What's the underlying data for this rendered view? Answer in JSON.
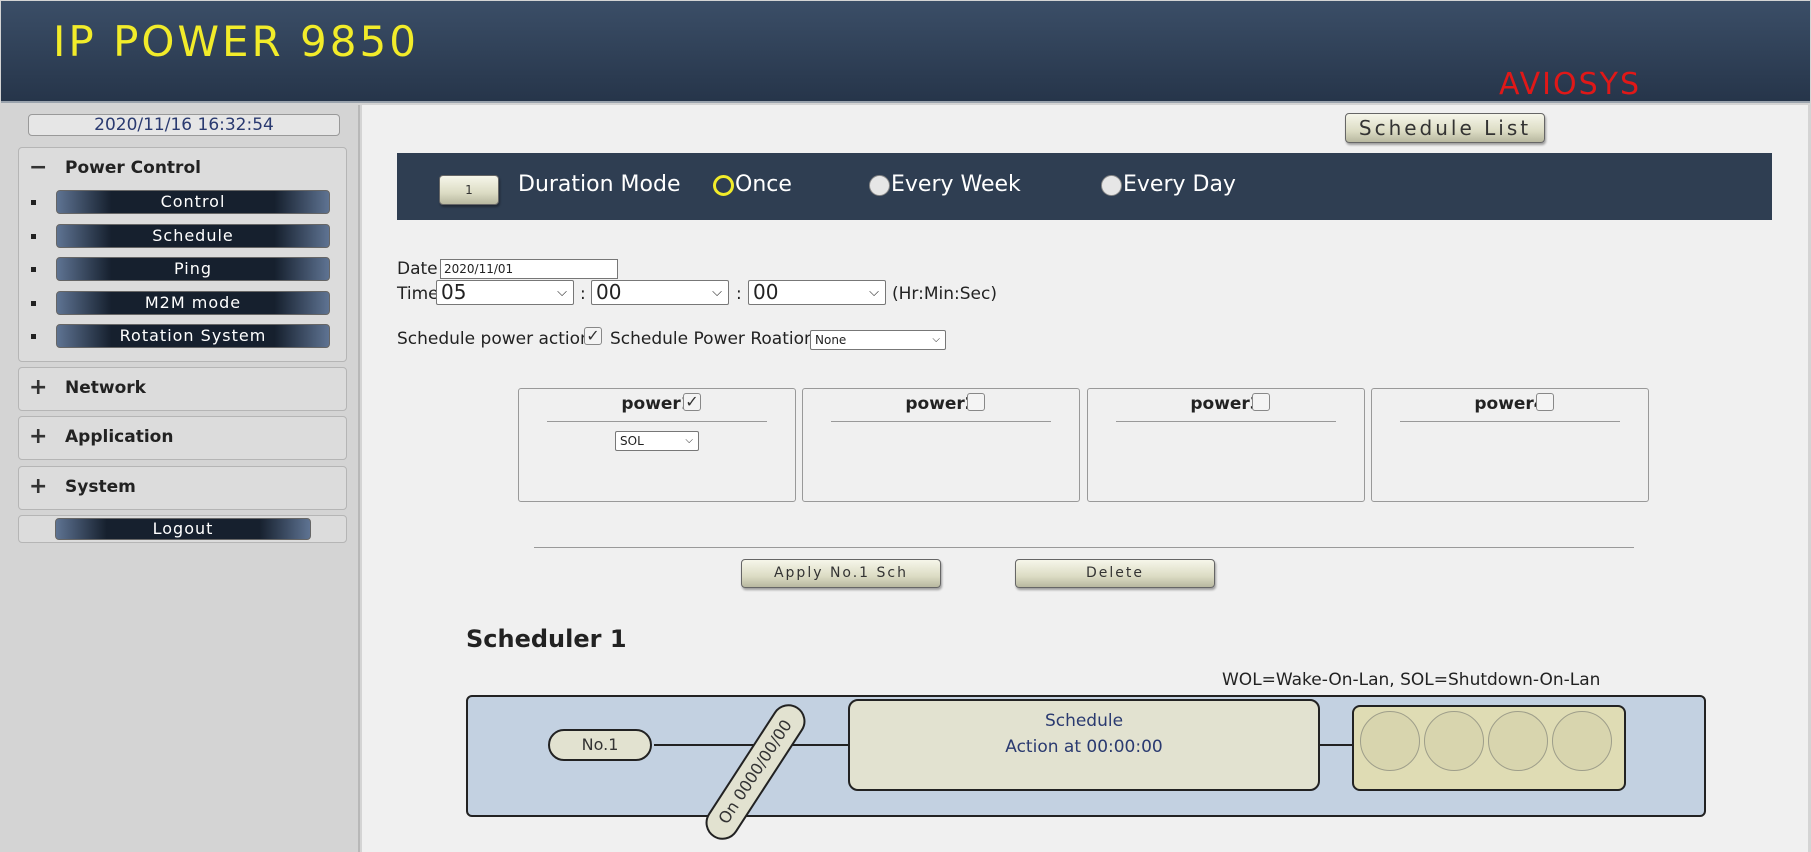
{
  "app": {
    "title": "IP POWER 9850",
    "brand": "AVIOSYS"
  },
  "sidebar": {
    "datetime": "2020/11/16 16:32:54",
    "power_control": {
      "label": "Power Control",
      "sign": "−",
      "items": [
        "Control",
        "Schedule",
        "Ping",
        "M2M mode",
        "Rotation System"
      ]
    },
    "network": {
      "label": "Network",
      "sign": "+"
    },
    "application": {
      "label": "Application",
      "sign": "+"
    },
    "system": {
      "label": "System",
      "sign": "+"
    },
    "logout": "Logout"
  },
  "main": {
    "schedule_list_button": "Schedule List",
    "schedule_number": "1",
    "duration_mode_label": "Duration Mode",
    "modes": [
      {
        "label": "Once",
        "selected": true
      },
      {
        "label": "Every Week",
        "selected": false
      },
      {
        "label": "Every Day",
        "selected": false
      }
    ],
    "date_label": "Date",
    "date_value": "2020/11/01",
    "time_label": "Time",
    "time_hour": "05",
    "time_min": "00",
    "time_sec": "00",
    "time_sep": ":",
    "time_units": "(Hr:Min:Sec)",
    "schedule_power_action_label": "Schedule power action",
    "schedule_power_action_checked": "✓",
    "schedule_power_rotation_label": "Schedule Power Roation",
    "schedule_power_rotation_value": "None",
    "powers": [
      {
        "label": "power1",
        "checked": "✓",
        "action": "SOL"
      },
      {
        "label": "power2",
        "checked": ""
      },
      {
        "label": "power3",
        "checked": ""
      },
      {
        "label": "power4",
        "checked": ""
      }
    ],
    "apply_button": "Apply No.1 Sch",
    "delete_button": "Delete",
    "scheduler_title": "Scheduler 1",
    "legend_note": "WOL=Wake-On-Lan, SOL=Shutdown-On-Lan",
    "diagram": {
      "number": "No.1",
      "on_date": "On 0000/00/00",
      "card_title": "Schedule",
      "card_action": "Action at 00:00:00"
    }
  },
  "colors": {
    "header_bg": "#2f3e52",
    "title_yellow": "#f2ec2a",
    "brand_red": "#e01818",
    "panel_blue": "#c3d1e1"
  }
}
